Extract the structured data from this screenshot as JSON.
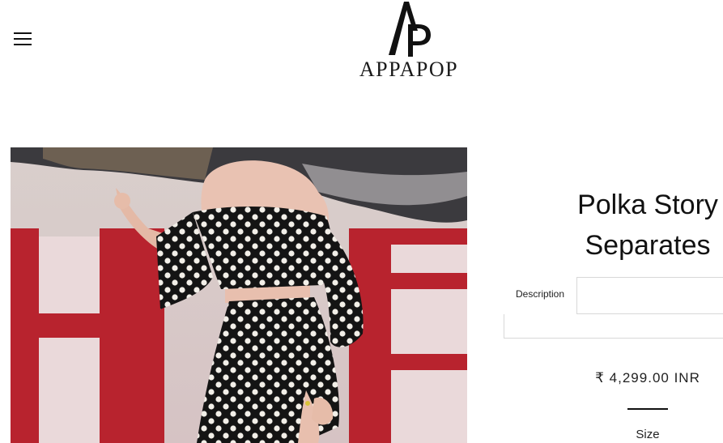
{
  "header": {
    "menu_icon": "hamburger-menu-icon",
    "logo_monogram": "AP",
    "logo_text": "APPAPOP"
  },
  "product": {
    "image_alt": "",
    "title_line1": "Polka Story",
    "title_line2": "Separates",
    "tabs": [
      {
        "label": "Description"
      }
    ],
    "price": "₹ 4,299.00 INR",
    "size_label": "Size"
  },
  "colors": {
    "accent": "#111111",
    "border": "#d8d8d8",
    "wall_red": "#b8232e",
    "dress_black": "#141414"
  }
}
